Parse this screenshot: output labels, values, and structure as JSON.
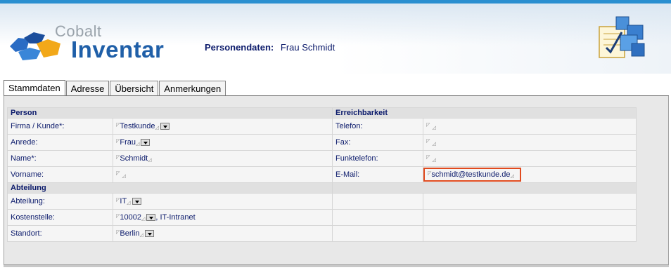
{
  "app": {
    "logo_small": "Cobalt",
    "logo_big": "Inventar",
    "page_label": "Personendaten:",
    "page_value": "Frau Schmidt"
  },
  "tabs": [
    {
      "label": "Stammdaten",
      "active": true
    },
    {
      "label": "Adresse",
      "active": false
    },
    {
      "label": "Übersicht",
      "active": false
    },
    {
      "label": "Anmerkungen",
      "active": false
    }
  ],
  "sections": {
    "person": "Person",
    "erreichbarkeit": "Erreichbarkeit",
    "abteilung": "Abteilung"
  },
  "person": {
    "firma_label": "Firma / Kunde*:",
    "firma_value": "Testkunde",
    "anrede_label": "Anrede:",
    "anrede_value": "Frau",
    "name_label": "Name*:",
    "name_value": "Schmidt",
    "vorname_label": "Vorname:",
    "vorname_value": ""
  },
  "contact": {
    "telefon_label": "Telefon:",
    "fax_label": "Fax:",
    "funk_label": "Funktelefon:",
    "email_label": "E-Mail:",
    "email_value": "schmidt@testkunde.de"
  },
  "department": {
    "abteilung_label": "Abteilung:",
    "abteilung_value": "IT",
    "kosten_label": "Kostenstelle:",
    "kosten_value": "10002",
    "kosten_name": ", IT-Intranet",
    "standort_label": "Standort:",
    "standort_value": "Berlin"
  },
  "colors": {
    "accent": "#1f5fa8",
    "highlight": "#e04a1e",
    "text": "#0b1a6b"
  }
}
